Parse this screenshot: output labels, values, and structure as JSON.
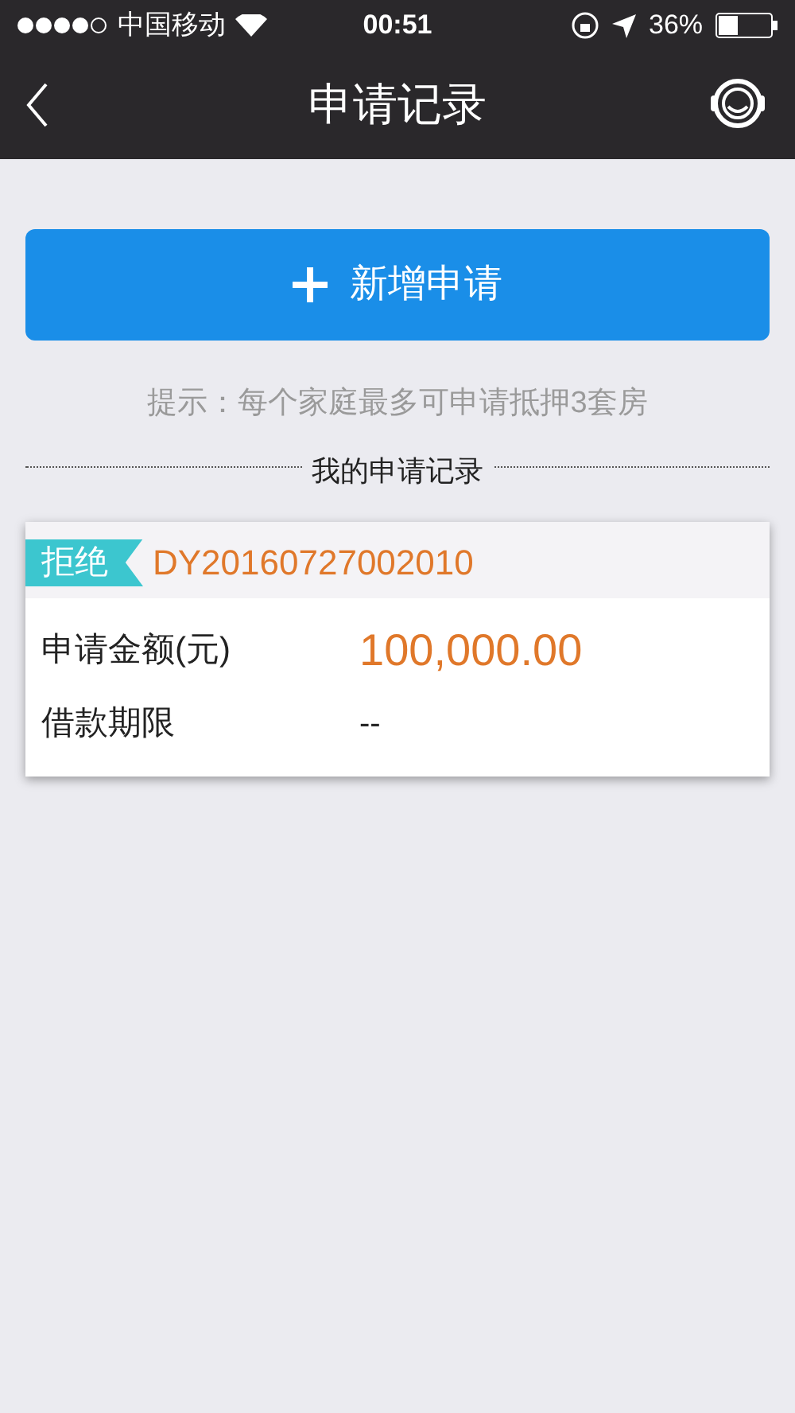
{
  "status_bar": {
    "carrier": "中国移动",
    "time": "00:51",
    "battery": "36%"
  },
  "nav": {
    "title": "申请记录"
  },
  "new_button": {
    "label": "新增申请"
  },
  "hint": "提示：每个家庭最多可申请抵押3套房",
  "section_title": "我的申请记录",
  "records": [
    {
      "status": "拒绝",
      "color": "#3cc6cf",
      "number": "DY20160727002010",
      "fields": [
        {
          "label": "申请金额(元)",
          "value": "100,000.00",
          "kind": "amount"
        },
        {
          "label": "借款期限",
          "value": "--",
          "kind": "plain"
        }
      ]
    }
  ]
}
